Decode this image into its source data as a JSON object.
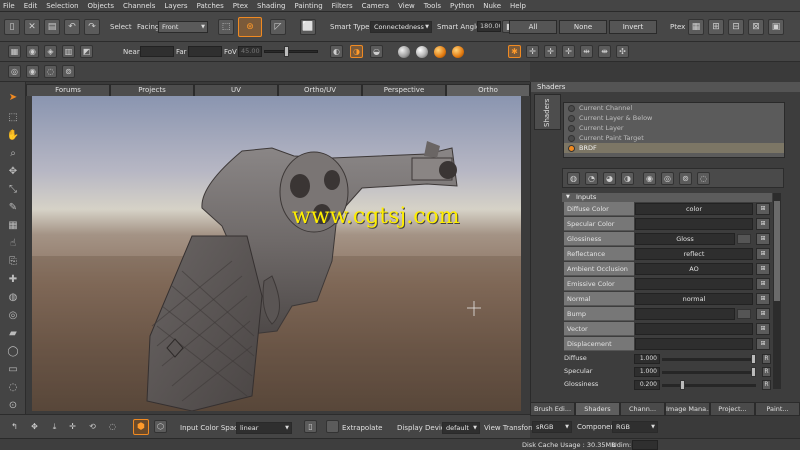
{
  "menu": [
    "File",
    "Edit",
    "Selection",
    "Objects",
    "Channels",
    "Layers",
    "Patches",
    "Ptex",
    "Shading",
    "Painting",
    "Filters",
    "Camera",
    "View",
    "Tools",
    "Python",
    "Nuke",
    "Help"
  ],
  "toolbar1": {
    "select_label": "Select",
    "facing_label": "Facing",
    "facing_value": "Front",
    "smart_type_label": "Smart Type:",
    "smart_type_value": "Connectedness",
    "smart_angle_label": "Smart Angle",
    "smart_angle_value": "180.00",
    "all_label": "All",
    "none_label": "None",
    "invert_label": "Invert",
    "ptex_label": "Ptex"
  },
  "toolbar2": {
    "near_label": "Near",
    "far_label": "Far",
    "fov_label": "FoV",
    "fov_value": "45.00"
  },
  "viewport_tabs": [
    "Forums",
    "Projects",
    "UV",
    "Ortho/UV",
    "Perspective",
    "Ortho"
  ],
  "viewport": {
    "watermark": "www.cgtsj.com"
  },
  "bottombar": {
    "input_color_space_label": "Input Color Space",
    "input_color_space_value": "linear",
    "extrapolate_label": "Extrapolate",
    "display_device_label": "Display Device",
    "display_device_value": "default",
    "view_transform_label": "View Transform",
    "view_transform_value": "sRGB",
    "component_label": "Component",
    "component_value": "RGB"
  },
  "status": {
    "disk_cache_label": "Disk Cache Usage : 30.35MB",
    "udim_label": "Udim:"
  },
  "shaders_panel": {
    "title": "Shaders",
    "vertical_tab": "Shaders",
    "channels": [
      {
        "label": "Current Channel",
        "selected": false
      },
      {
        "label": "Current Layer & Below",
        "selected": false
      },
      {
        "label": "Current Layer",
        "selected": false
      },
      {
        "label": "Current Paint Target",
        "selected": false
      },
      {
        "label": "BRDF",
        "selected": true
      }
    ],
    "inputs_title": "Inputs",
    "params": [
      {
        "label": "Diffuse Color",
        "value": "color"
      },
      {
        "label": "Specular Color",
        "value": ""
      },
      {
        "label": "Glossiness",
        "value": "Gloss"
      },
      {
        "label": "Reflectance",
        "value": "reflect"
      },
      {
        "label": "Ambient Occlusion",
        "value": "AO"
      },
      {
        "label": "Emissive Color",
        "value": ""
      },
      {
        "label": "Normal",
        "value": "normal"
      },
      {
        "label": "Bump",
        "value": ""
      },
      {
        "label": "Vector",
        "value": ""
      },
      {
        "label": "Displacement",
        "value": ""
      }
    ],
    "sliders": [
      {
        "label": "Diffuse",
        "value": "1.000",
        "level": 1.0
      },
      {
        "label": "Specular",
        "value": "1.000",
        "level": 1.0
      },
      {
        "label": "Glossiness",
        "value": "0.200",
        "level": 0.2
      }
    ],
    "r_label": "R"
  },
  "panel_tabs": [
    "Brush Edi...",
    "Shaders",
    "Chann...",
    "Image Mana...",
    "Project...",
    "Paint..."
  ]
}
